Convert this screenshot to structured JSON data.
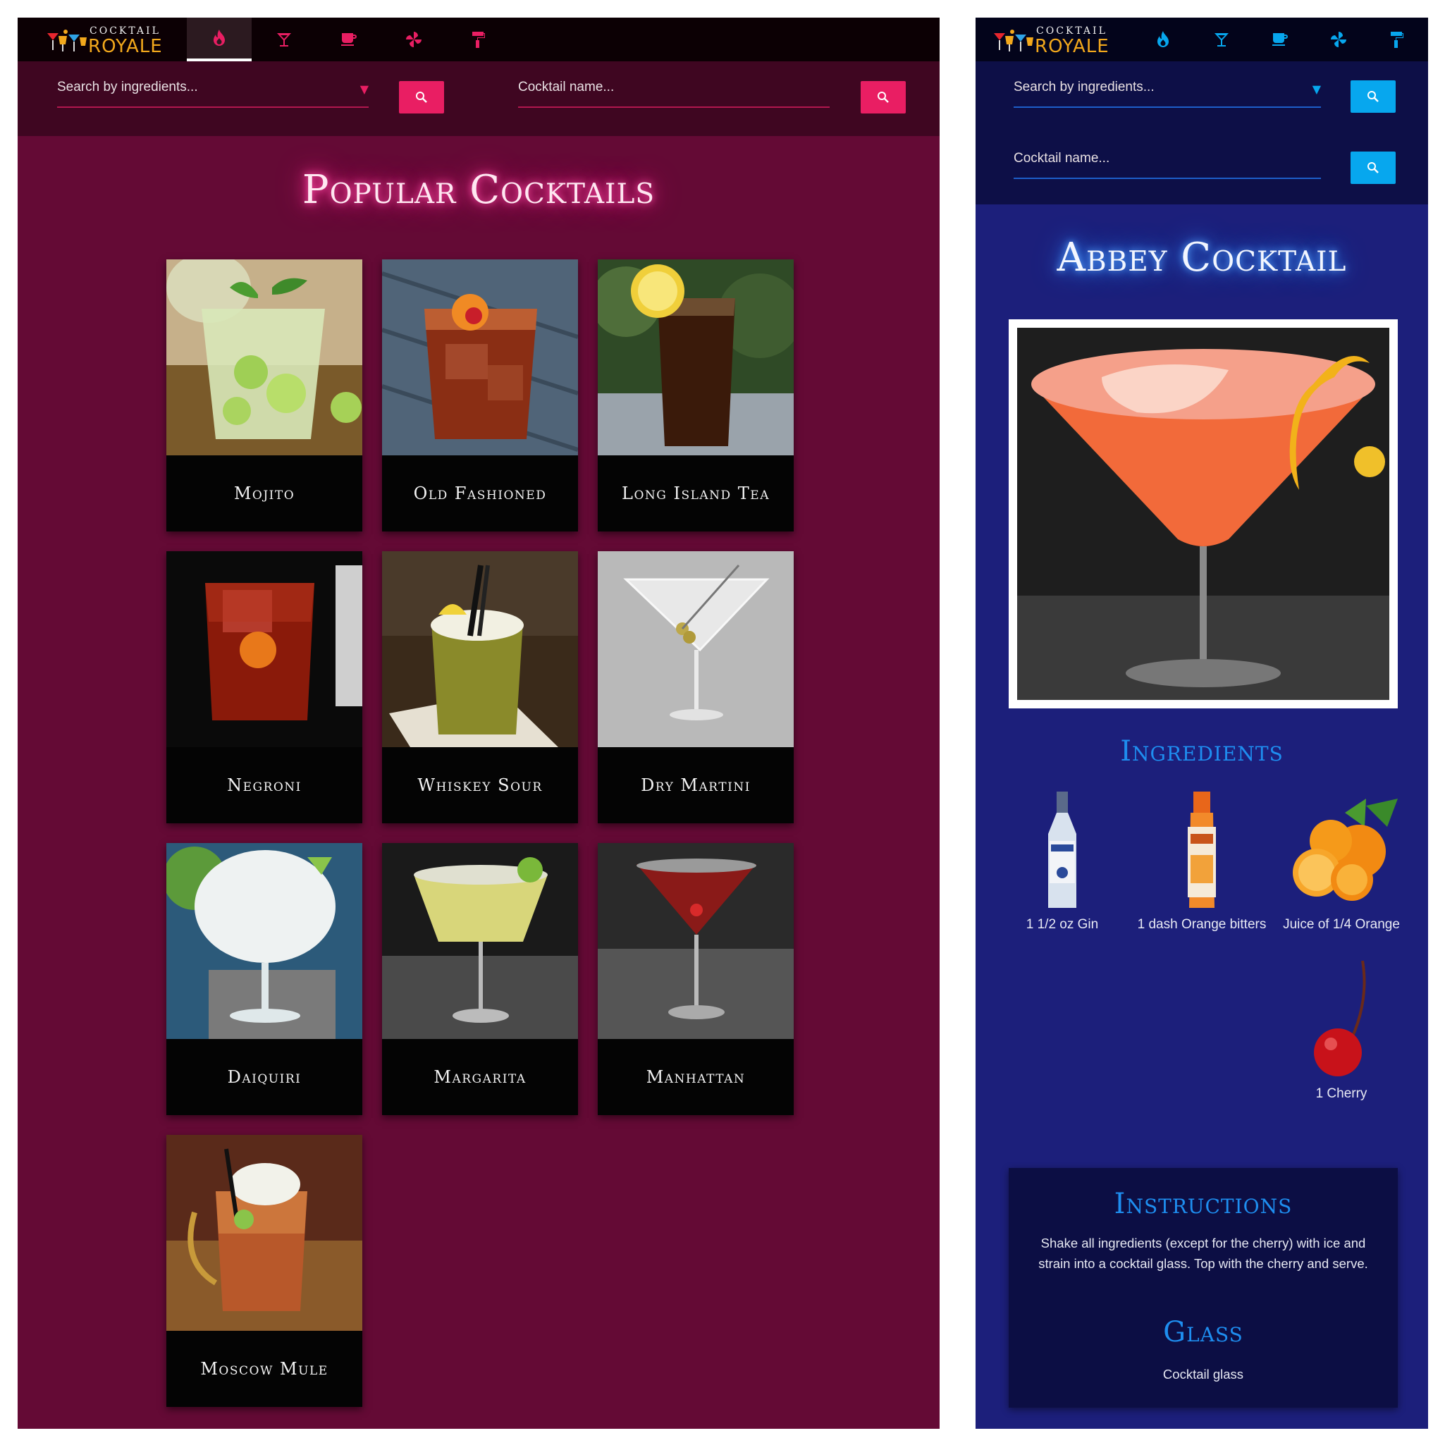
{
  "left_app": {
    "logo": {
      "top": "COCKTAIL",
      "bottom": "ROYALE"
    },
    "nav_icons": [
      "fire-icon",
      "cocktail-glass-icon",
      "coffee-cup-icon",
      "pinwheel-icon",
      "paint-roller-icon"
    ],
    "active_nav": "fire-icon",
    "search": {
      "ingredients_placeholder": "Search by ingredients...",
      "dropdown_arrow": "▼",
      "name_placeholder": "Cocktail name..."
    },
    "page_title": "Popular Cocktails",
    "cocktails": [
      {
        "name": "Mojito"
      },
      {
        "name": "Old Fashioned"
      },
      {
        "name": "Long Island Tea"
      },
      {
        "name": "Negroni"
      },
      {
        "name": "Whiskey Sour"
      },
      {
        "name": "Dry Martini"
      },
      {
        "name": "Daiquiri"
      },
      {
        "name": "Margarita"
      },
      {
        "name": "Manhattan"
      },
      {
        "name": "Moscow Mule"
      }
    ],
    "colors": {
      "background": "#640a35",
      "nav": "#0c0004",
      "search_bar": "#3f0621",
      "accent": "#e91e63"
    }
  },
  "right_app": {
    "logo": {
      "top": "COCKTAIL",
      "bottom": "ROYALE"
    },
    "nav_icons": [
      "fire-icon",
      "cocktail-glass-icon",
      "coffee-cup-icon",
      "pinwheel-icon",
      "paint-roller-icon"
    ],
    "search": {
      "ingredients_placeholder": "Search by ingredients...",
      "dropdown_arrow": "▼",
      "name_placeholder": "Cocktail name..."
    },
    "page_title": "Abbey Cocktail",
    "ingredients_heading": "Ingredients",
    "ingredients": [
      {
        "label": "1 1/2 oz Gin",
        "icon": "gin-bottle-icon"
      },
      {
        "label": "1 dash Orange bitters",
        "icon": "bitters-bottle-icon"
      },
      {
        "label": "Juice of 1/4 Orange",
        "icon": "orange-icon"
      },
      {
        "label": "1 Cherry",
        "icon": "cherry-icon"
      }
    ],
    "instructions_heading": "Instructions",
    "instructions": "Shake all ingredients (except for the cherry) with ice and strain into a cocktail glass. Top with the cherry and serve.",
    "glass_heading": "Glass",
    "glass": "Cocktail glass",
    "colors": {
      "background": "#1c1f7b",
      "nav": "#03041b",
      "search_bar": "#0d0f47",
      "accent": "#07a7ee",
      "heading": "#1e8ef0"
    }
  }
}
